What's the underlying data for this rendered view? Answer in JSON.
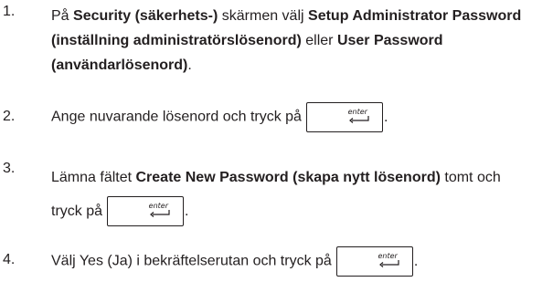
{
  "steps": [
    {
      "number": "1.",
      "parts": [
        {
          "t": "På ",
          "b": false
        },
        {
          "t": "Security (säkerhets-)",
          "b": true
        },
        {
          "t": " skärmen välj ",
          "b": false
        },
        {
          "t": "Setup Administrator Password (inställning administratörslösenord)",
          "b": true
        },
        {
          "t": " eller ",
          "b": false
        },
        {
          "t": "User Password (användarlösenord)",
          "b": true
        },
        {
          "t": ".",
          "b": false
        }
      ]
    },
    {
      "number": "2.",
      "parts": [
        {
          "t": "Ange nuvarande lösenord och tryck på",
          "b": false
        },
        {
          "key": "enter"
        },
        {
          "t": ".",
          "b": false
        }
      ]
    },
    {
      "number": "3.",
      "parts": [
        {
          "t": "Lämna fältet ",
          "b": false
        },
        {
          "t": "Create New Password (skapa nytt lösenord)",
          "b": true
        },
        {
          "t": " tomt och tryck på",
          "b": false
        },
        {
          "key": "enter"
        },
        {
          "t": ".",
          "b": false
        }
      ]
    },
    {
      "number": "4.",
      "parts": [
        {
          "t": "Välj Yes (Ja) i bekräftelserutan och tryck på",
          "b": false
        },
        {
          "key": "enter"
        },
        {
          "t": ".",
          "b": false
        }
      ]
    }
  ],
  "key_label": "enter"
}
